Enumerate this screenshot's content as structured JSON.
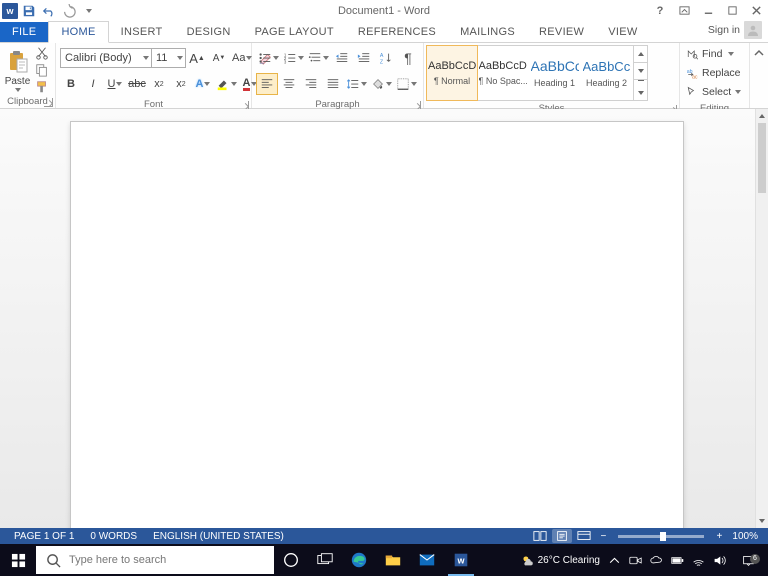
{
  "title": "Document1 - Word",
  "signin_label": "Sign in",
  "tabs": {
    "file": "FILE",
    "home": "HOME",
    "insert": "INSERT",
    "design": "DESIGN",
    "pagelayout": "PAGE LAYOUT",
    "references": "REFERENCES",
    "mailings": "MAILINGS",
    "review": "REVIEW",
    "view": "VIEW"
  },
  "clipboard": {
    "paste": "Paste",
    "label": "Clipboard"
  },
  "font": {
    "name": "Calibri (Body)",
    "size": "11",
    "grow": "A",
    "shrink": "A",
    "case": "Aa",
    "bold": "B",
    "italic": "I",
    "underline": "U",
    "strike": "abc",
    "sub": "x",
    "sup": "x",
    "label": "Font"
  },
  "paragraph": {
    "label": "Paragraph"
  },
  "styles": {
    "label": "Styles",
    "items": [
      {
        "preview": "AaBbCcDc",
        "name": "¶ Normal"
      },
      {
        "preview": "AaBbCcDc",
        "name": "¶ No Spac..."
      },
      {
        "preview": "AaBbCc",
        "name": "Heading 1"
      },
      {
        "preview": "AaBbCcC",
        "name": "Heading 2"
      }
    ]
  },
  "editing": {
    "find": "Find",
    "replace": "Replace",
    "select": "Select",
    "label": "Editing"
  },
  "status": {
    "page": "PAGE 1 OF 1",
    "words": "0 WORDS",
    "lang": "ENGLISH (UNITED STATES)",
    "zoom": "100%"
  },
  "taskbar": {
    "search_placeholder": "Type here to search",
    "weather_temp": "26°C",
    "weather_cond": "Clearing",
    "time1": "",
    "time2": "",
    "notif_count": "6"
  }
}
